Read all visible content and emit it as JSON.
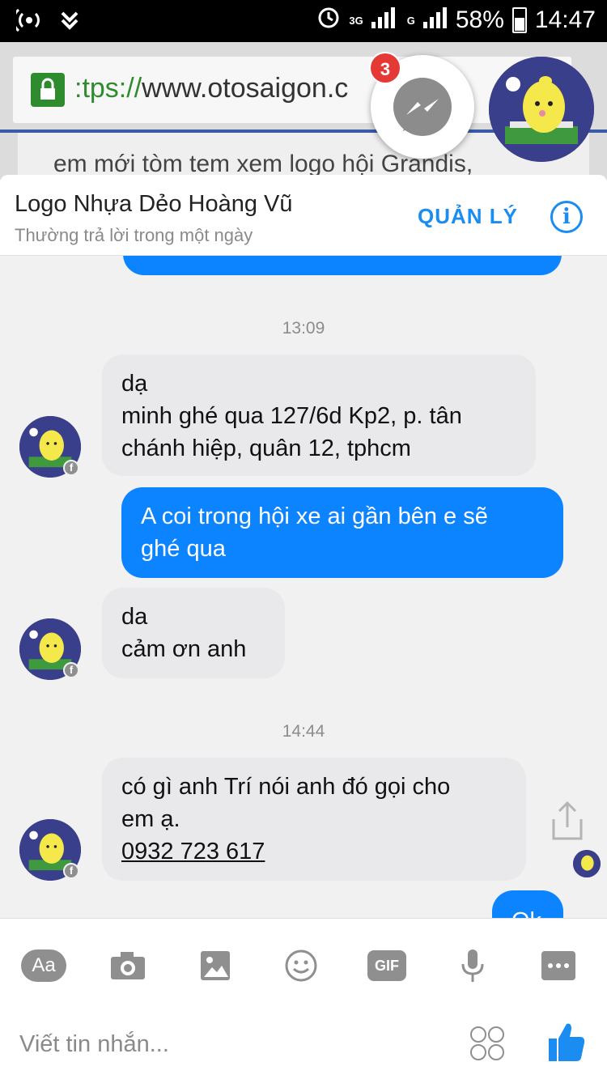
{
  "status_bar": {
    "network": "3G",
    "network2": "G",
    "battery": "58%",
    "time": "14:47",
    "battery_level": 0.58
  },
  "browser": {
    "url_prefix": ":tps://",
    "url_rest": "www.otosaigon.c",
    "page_text": "em mới tòm tem xem logo hội Grandis,"
  },
  "chat_heads": {
    "badge_count": "3"
  },
  "header": {
    "contact_name": "Logo Nhựa Dẻo Hoàng Vũ",
    "status": "Thường trả lời trong một ngày",
    "manage_label": "QUẢN LÝ",
    "info_label": "i"
  },
  "conversation": {
    "timestamps": [
      "13:09",
      "14:44"
    ],
    "messages": [
      {
        "from": "them",
        "lines": [
          "dạ",
          "minh ghé qua 127/6d Kp2, p. tân",
          "chánh hiệp, quân 12, tphcm"
        ]
      },
      {
        "from": "me",
        "lines": [
          "A coi trong hội xe ai gần bên e sẽ",
          "ghé qua"
        ]
      },
      {
        "from": "them",
        "lines": [
          "da",
          "cảm ơn anh"
        ]
      },
      {
        "from": "them",
        "lines": [
          "có gì anh Trí nói anh đó gọi cho",
          "em ạ.",
          "0932 723 617"
        ]
      },
      {
        "from": "me",
        "lines": [
          "Ok"
        ]
      }
    ]
  },
  "composer": {
    "tools": [
      "Aa",
      "camera-icon",
      "image-icon",
      "emoji-icon",
      "GIF",
      "microphone-icon",
      "more-icon"
    ],
    "aa_label": "Aa",
    "gif_label": "GIF",
    "placeholder": "Viết tin nhắn..."
  },
  "colors": {
    "accent": "#1a8cf2",
    "outgoing_bubble": "#0d84ff",
    "incoming_bubble": "#e9e9eb"
  }
}
